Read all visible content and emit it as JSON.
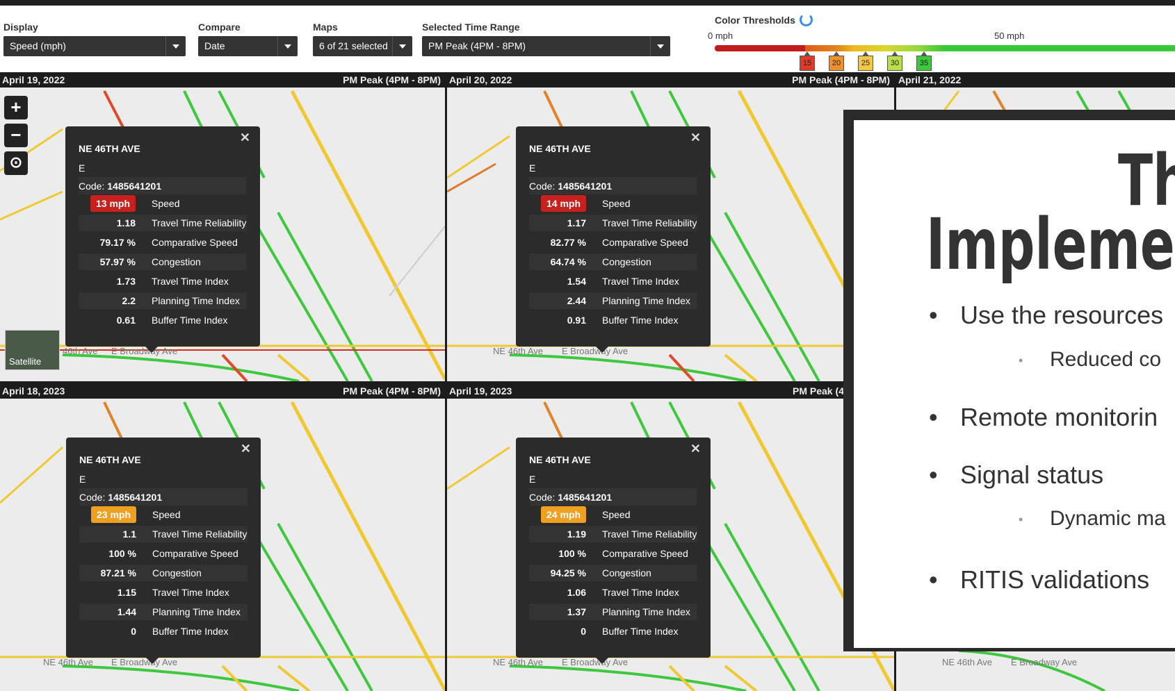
{
  "controls": {
    "display": {
      "label": "Display",
      "value": "Speed (mph)"
    },
    "compare": {
      "label": "Compare",
      "value": "Date"
    },
    "maps": {
      "label": "Maps",
      "value": "6 of 21 selected"
    },
    "time_range": {
      "label": "Selected Time Range",
      "value": "PM Peak (4PM - 8PM)"
    }
  },
  "color_thresholds": {
    "title": "Color Thresholds",
    "tick_start": "0 mph",
    "tick_mid": "50 mph",
    "markers": [
      {
        "label": "15",
        "color": "#e03a2a"
      },
      {
        "label": "20",
        "color": "#f0902a"
      },
      {
        "label": "25",
        "color": "#f5c842"
      },
      {
        "label": "30",
        "color": "#b8e04a"
      },
      {
        "label": "35",
        "color": "#3ec83e"
      }
    ]
  },
  "panels": [
    {
      "date": "April 19, 2022",
      "range": "PM Peak (4PM - 8PM)",
      "popup": {
        "road": "NE 46TH AVE",
        "direction": "E",
        "code_label": "Code: ",
        "code": "1485641201",
        "speed": "13 mph",
        "speed_color": "#c8201c",
        "metrics": [
          {
            "value": "1.18",
            "label": "Travel Time Reliability"
          },
          {
            "value": "79.17 %",
            "label": "Comparative Speed"
          },
          {
            "value": "57.97 %",
            "label": "Congestion"
          },
          {
            "value": "1.73",
            "label": "Travel Time Index"
          },
          {
            "value": "2.2",
            "label": "Planning Time Index"
          },
          {
            "value": "0.61",
            "label": "Buffer Time Index"
          }
        ]
      }
    },
    {
      "date": "April 20, 2022",
      "range": "PM Peak (4PM - 8PM)",
      "popup": {
        "road": "NE 46TH AVE",
        "direction": "E",
        "code_label": "Code: ",
        "code": "1485641201",
        "speed": "14 mph",
        "speed_color": "#c8201c",
        "metrics": [
          {
            "value": "1.17",
            "label": "Travel Time Reliability"
          },
          {
            "value": "82.77 %",
            "label": "Comparative Speed"
          },
          {
            "value": "64.74 %",
            "label": "Congestion"
          },
          {
            "value": "1.54",
            "label": "Travel Time Index"
          },
          {
            "value": "2.44",
            "label": "Planning Time Index"
          },
          {
            "value": "0.91",
            "label": "Buffer Time Index"
          }
        ]
      }
    },
    {
      "date": "April 21, 2022",
      "range": ""
    },
    {
      "date": "April 18, 2023",
      "range": "PM Peak (4PM - 8PM)",
      "popup": {
        "road": "NE 46TH AVE",
        "direction": "E",
        "code_label": "Code: ",
        "code": "1485641201",
        "speed": "23 mph",
        "speed_color": "#f0a020",
        "metrics": [
          {
            "value": "1.1",
            "label": "Travel Time Reliability"
          },
          {
            "value": "100 %",
            "label": "Comparative Speed"
          },
          {
            "value": "87.21 %",
            "label": "Congestion"
          },
          {
            "value": "1.15",
            "label": "Travel Time Index"
          },
          {
            "value": "1.44",
            "label": "Planning Time Index"
          },
          {
            "value": "0",
            "label": "Buffer Time Index"
          }
        ]
      }
    },
    {
      "date": "April 19, 2023",
      "range": "PM Peak (4",
      "popup": {
        "road": "NE 46TH AVE",
        "direction": "E",
        "code_label": "Code: ",
        "code": "1485641201",
        "speed": "24 mph",
        "speed_color": "#f0a020",
        "metrics": [
          {
            "value": "1.19",
            "label": "Travel Time Reliability"
          },
          {
            "value": "100 %",
            "label": "Comparative Speed"
          },
          {
            "value": "94.25 %",
            "label": "Congestion"
          },
          {
            "value": "1.06",
            "label": "Travel Time Index"
          },
          {
            "value": "1.37",
            "label": "Planning Time Index"
          },
          {
            "value": "0",
            "label": "Buffer Time Index"
          }
        ]
      }
    }
  ],
  "map_labels": {
    "street_a": "NE 46th Ave",
    "street_b": "E Broadway Ave",
    "street_a_partial": "46th Ave",
    "satellite": "Satellite",
    "zoom_in": "+",
    "zoom_out": "−"
  },
  "slide": {
    "title_line1": "Th",
    "title_line2": "Impleme",
    "bullets": [
      {
        "level": 1,
        "text": "Use the resources"
      },
      {
        "level": 2,
        "text": "Reduced co"
      },
      {
        "level": 1,
        "text": "Remote monitorin"
      },
      {
        "level": 1,
        "text": "Signal status"
      },
      {
        "level": 2,
        "text": "Dynamic ma"
      },
      {
        "level": 1,
        "text": "RITIS validations"
      }
    ]
  }
}
